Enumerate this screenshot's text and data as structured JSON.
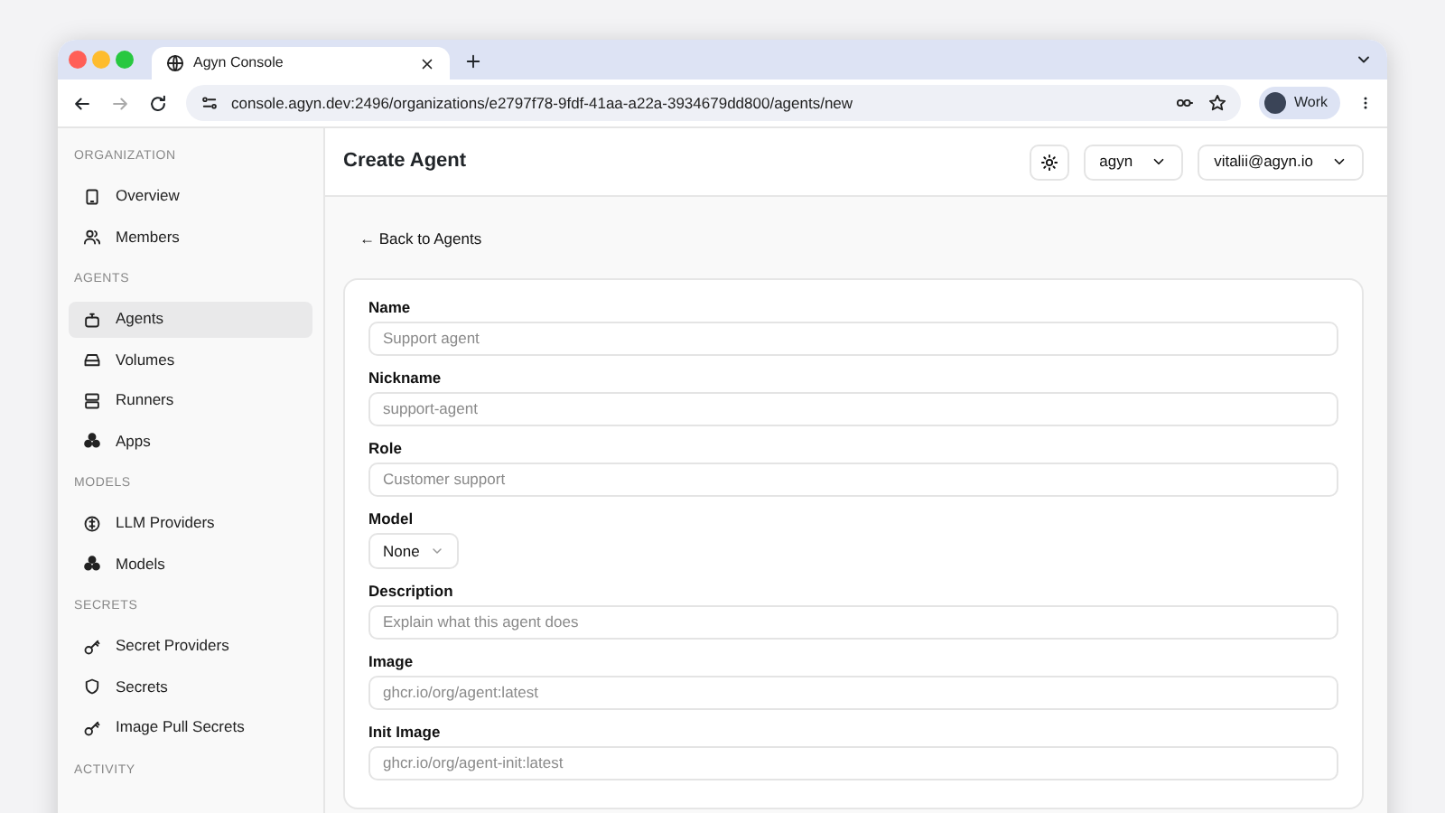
{
  "browser": {
    "tab": {
      "title": "Agyn Console",
      "selected": true
    },
    "url": "console.agyn.dev:2496/organizations/e2797f78-9fdf-41aa-a22a-3934679dd800/agents/new",
    "profile": "Work"
  },
  "sidebar": {
    "sections": [
      {
        "title": "ORGANIZATION",
        "items": [
          {
            "label": "Overview",
            "selected": false
          },
          {
            "label": "Members",
            "selected": false
          }
        ]
      },
      {
        "title": "AGENTS",
        "items": [
          {
            "label": "Agents",
            "selected": true
          },
          {
            "label": "Volumes",
            "selected": false
          },
          {
            "label": "Runners",
            "selected": false
          },
          {
            "label": "Apps",
            "selected": false
          }
        ]
      },
      {
        "title": "MODELS",
        "items": [
          {
            "label": "LLM Providers",
            "selected": false
          },
          {
            "label": "Models",
            "selected": false
          }
        ]
      },
      {
        "title": "SECRETS",
        "items": [
          {
            "label": "Secret Providers",
            "selected": false
          },
          {
            "label": "Secrets",
            "selected": false
          },
          {
            "label": "Image Pull Secrets",
            "selected": false
          }
        ]
      },
      {
        "title": "ACTIVITY"
      }
    ]
  },
  "header": {
    "title": "Create Agent",
    "organization": "agyn",
    "user": "vitalii@agyn.io"
  },
  "back_link": "← Back to Agents",
  "form": {
    "fields": [
      {
        "kind": "input",
        "label": "Name",
        "placeholder": "Support agent"
      },
      {
        "kind": "input",
        "label": "Nickname",
        "placeholder": "support-agent"
      },
      {
        "kind": "input",
        "label": "Role",
        "placeholder": "Customer support"
      },
      {
        "kind": "select",
        "label": "Model",
        "value": "None"
      },
      {
        "kind": "input",
        "label": "Description",
        "placeholder": "Explain what this agent does"
      },
      {
        "kind": "input",
        "label": "Image",
        "placeholder": "ghcr.io/org/agent:latest"
      },
      {
        "kind": "input",
        "label": "Init Image",
        "placeholder": "ghcr.io/org/agent-init:latest"
      }
    ]
  }
}
